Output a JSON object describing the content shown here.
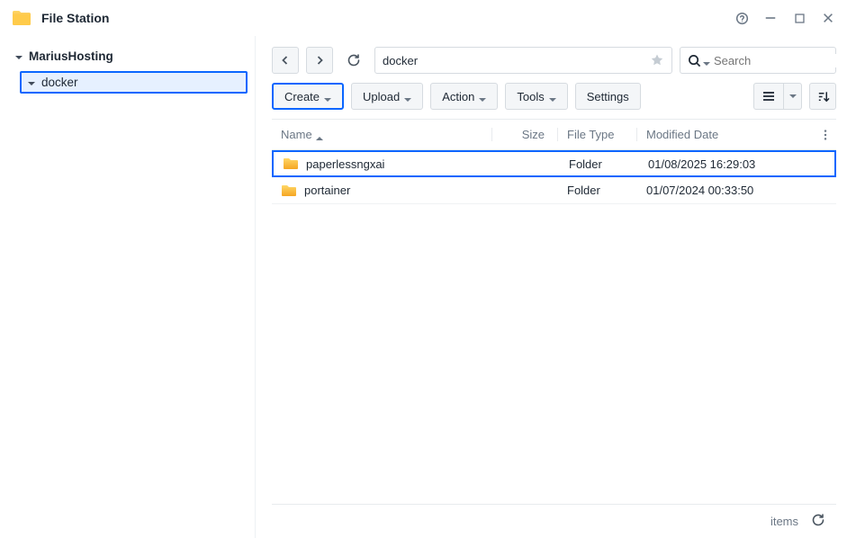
{
  "title": "File Station",
  "sidebar": {
    "root": {
      "label": "MariusHosting"
    },
    "children": [
      {
        "label": "docker"
      }
    ]
  },
  "path": "docker",
  "search_placeholder": "Search",
  "buttons": {
    "create": "Create",
    "upload": "Upload",
    "action": "Action",
    "tools": "Tools",
    "settings": "Settings"
  },
  "columns": {
    "name": "Name",
    "size": "Size",
    "type": "File Type",
    "modified": "Modified Date"
  },
  "rows": [
    {
      "name": "paperlessngxai",
      "type": "Folder",
      "modified": "01/08/2025 16:29:03",
      "selected": true
    },
    {
      "name": "portainer",
      "type": "Folder",
      "modified": "01/07/2024 00:33:50",
      "selected": false
    }
  ],
  "footer": {
    "items_label": "items"
  }
}
